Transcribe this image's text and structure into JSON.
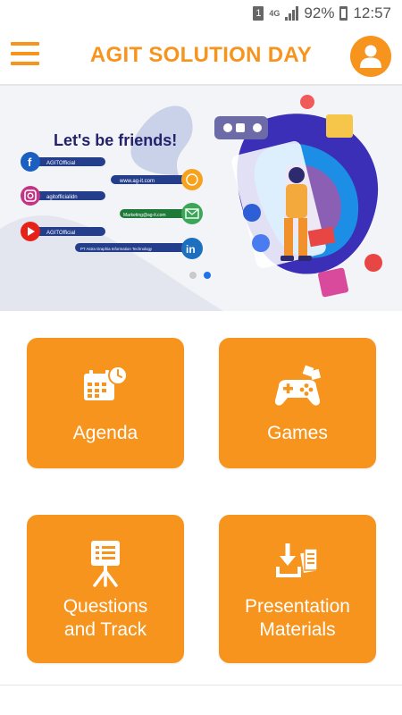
{
  "status_bar": {
    "sim": "1",
    "network": "4G",
    "battery": "92%",
    "time": "12:57"
  },
  "app_bar": {
    "title": "AGIT SOLUTION DAY",
    "accent_color": "#F7941D"
  },
  "banner": {
    "headline": "Let's be friends!",
    "social": [
      {
        "icon": "facebook-icon",
        "handle": "AGITOfficial"
      },
      {
        "icon": "instagram-icon",
        "handle": "agitofficialidn"
      },
      {
        "icon": "youtube-icon",
        "handle": "AGITOfficial"
      }
    ],
    "contacts": [
      {
        "icon": "globe-icon",
        "text": "www.ag-it.com"
      },
      {
        "icon": "mail-icon",
        "text": "Marketing@ag-it.com"
      },
      {
        "icon": "linkedin-icon",
        "text": "PT Astra Graphia Information Technology"
      }
    ],
    "slide_count": 2,
    "active_slide": 2
  },
  "menu_tiles": [
    {
      "icon": "calendar-icon",
      "label": "Agenda"
    },
    {
      "icon": "gamepad-icon",
      "label": "Games"
    },
    {
      "icon": "presentation-icon",
      "label": "Questions\nand Track"
    },
    {
      "icon": "download-documents-icon",
      "label": "Presentation\nMaterials"
    }
  ]
}
